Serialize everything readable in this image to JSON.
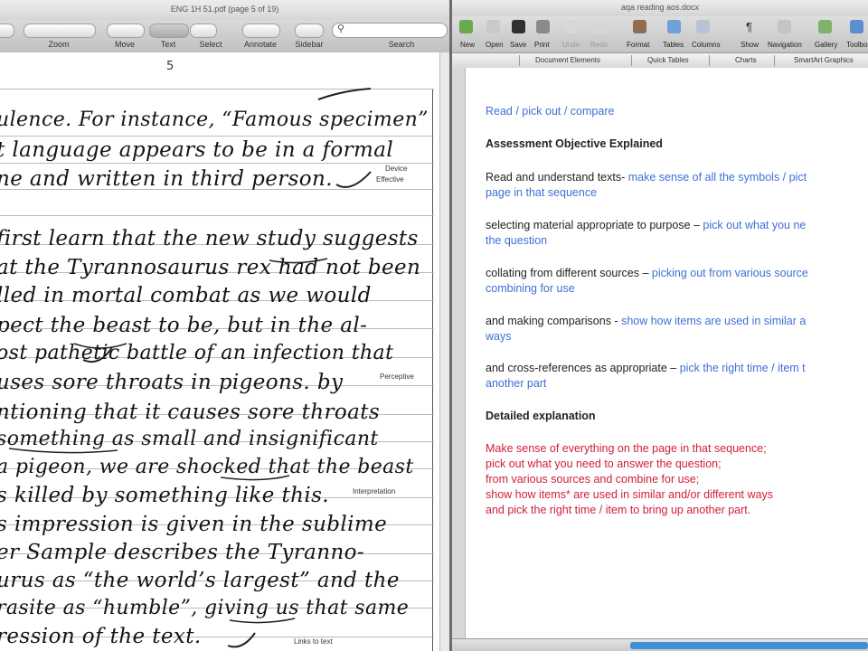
{
  "pdf": {
    "title": "ENG 1H 51.pdf (page 5 of 19)",
    "toolbar": [
      "Zoom",
      "Move",
      "Text",
      "Select",
      "Annotate",
      "Sidebar",
      "Search"
    ],
    "page_number": "5",
    "lines": [
      "ulence. For instance, “Famous specimen”",
      "t language appears to be in a formal",
      "ne and written in third person.",
      "first learn that the new study suggests",
      "at the Tyrannosaurus rex had not been",
      "lled in mortal combat as we would",
      "pect the beast to be, but in the al-",
      "ost pathetic battle of an infection that",
      "uses sore throats in pigeons. by",
      "ntioning that it causes sore throats",
      "something as small and insignificant",
      "a pigeon, we are shocked that the beast",
      "s killed by something like this.",
      "s impression is given in the sublime",
      "er Sample describes the Tyranno-",
      "urus as “the world’s largest” and the",
      "rasite as “humble”, giving us that same",
      "ression of the text."
    ],
    "margin_notes": {
      "device": "Device",
      "effective": "Effective",
      "perceptive": "Perceptive",
      "interpretation": "Interpretation",
      "links": "Links to text"
    }
  },
  "word": {
    "title": "aqa reading aos.docx",
    "toolbar": [
      "New",
      "Open",
      "Save",
      "Print",
      "Undo",
      "Redo",
      "Format",
      "Tables",
      "Columns",
      "Show",
      "Navigation",
      "Gallery",
      "Toolbox"
    ],
    "ribbon_tabs": [
      "Document Elements",
      "Quick Tables",
      "Charts",
      "SmartArt Graphics"
    ],
    "doc": {
      "line1": "Read / pick out / compare",
      "heading1": "Assessment Objective Explained",
      "p1_black": "Read and understand texts- ",
      "p1_blue_a": "make sense of all the symbols / pict",
      "p1_blue_b": "page in that sequence",
      "p2_black": "selecting material appropriate to purpose – ",
      "p2_blue_a": "pick out what you ne",
      "p2_blue_b": "the question",
      "p3_black": "collating from different sources – ",
      "p3_blue_a": "picking out from various source",
      "p3_blue_b": "combining for use",
      "p4_black": "and making comparisons - ",
      "p4_blue_a": "show how items are used in similar a",
      "p4_blue_b": "ways",
      "p5_black": "and cross-references as appropriate – ",
      "p5_blue_a": "pick the right time / item t",
      "p5_blue_b": "another part",
      "heading2": "Detailed explanation",
      "red": [
        "Make sense of everything on the page in that sequence;",
        "pick out what you need to answer the question;",
        "from various sources and combine for use;",
        "show how items* are used in similar and/or different ways",
        "and pick the right time / item to bring up another part."
      ]
    }
  },
  "colors": {
    "blue": "#3f6fd6",
    "red": "#d21e36",
    "progress": "#3d8fd6"
  }
}
